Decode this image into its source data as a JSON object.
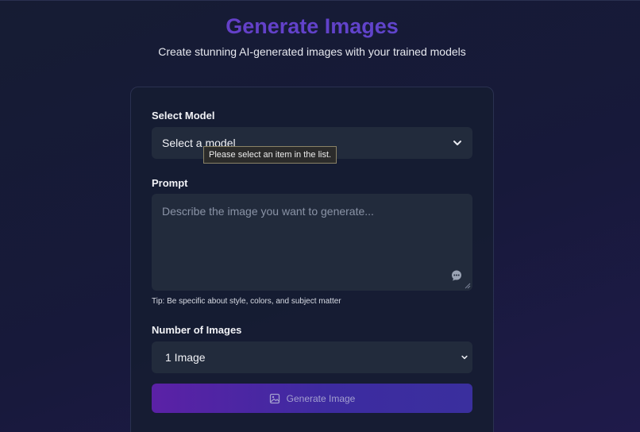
{
  "header": {
    "title": "Generate Images",
    "subtitle": "Create stunning AI-generated images with your trained models"
  },
  "form": {
    "model": {
      "label": "Select Model",
      "value": "Select a model",
      "validation_tooltip": "Please select an item in the list.",
      "icon": "chevron-down-icon"
    },
    "prompt": {
      "label": "Prompt",
      "placeholder": "Describe the image you want to generate...",
      "tip": "Tip: Be specific about style, colors, and subject matter",
      "icon": "chat-bubble-icon"
    },
    "count": {
      "label": "Number of Images",
      "value": "1 Image",
      "icon": "chevron-down-icon"
    },
    "submit": {
      "label": "Generate Image",
      "icon": "image-icon"
    }
  },
  "colors": {
    "title": "#6a3bc4",
    "button_start": "#5b21a6",
    "button_end": "#3a2f9e",
    "input_bg": "#222b3c"
  }
}
